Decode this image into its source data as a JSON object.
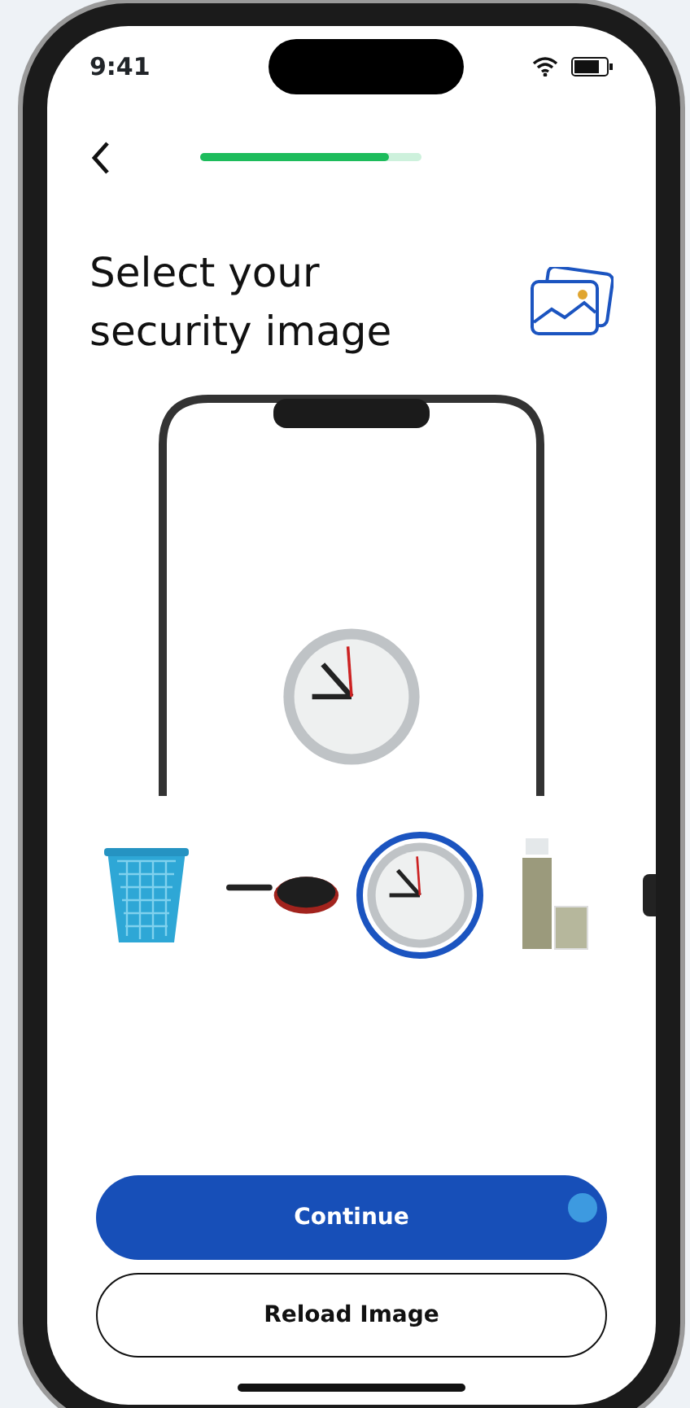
{
  "status_bar": {
    "time": "9:41"
  },
  "progress": {
    "level": 0.85
  },
  "title": "Select your security image",
  "preview": {
    "kind": "clock"
  },
  "thumbnails": [
    {
      "kind": "basket",
      "selected": false
    },
    {
      "kind": "pan",
      "selected": false
    },
    {
      "kind": "clock",
      "selected": true
    },
    {
      "kind": "bottle",
      "selected": false
    },
    {
      "kind": "partial",
      "selected": false
    }
  ],
  "buttons": [
    {
      "label": "Continue",
      "kind": "primary"
    },
    {
      "label": "Reload Image",
      "kind": "outline"
    }
  ]
}
